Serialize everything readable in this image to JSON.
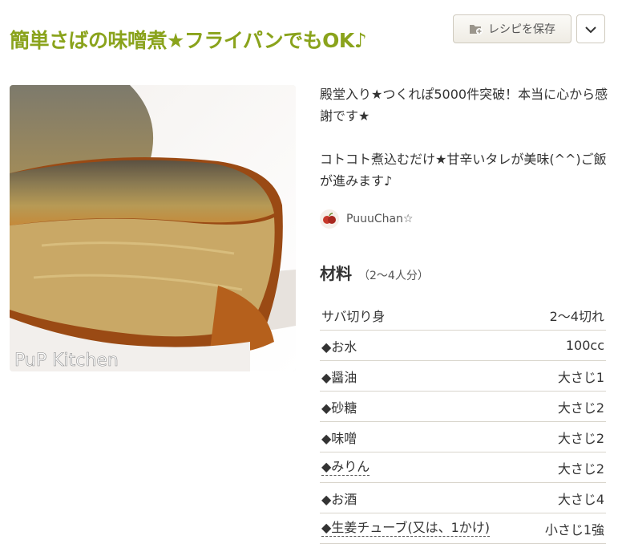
{
  "recipe": {
    "title": "簡単さばの味噌煮★フライパンでもOK♪",
    "save_label": "レシピを保存",
    "photo_watermark": "PuP Kitchen",
    "description": [
      "殿堂入り★つくれぽ5000件突破！本当に心から感謝です★",
      "コトコト煮込むだけ★甘辛いタレが美味(^^)ご飯が進みます♪"
    ],
    "author": "PuuuChan☆"
  },
  "ingredients": {
    "heading": "材料",
    "servings": "（2〜4人分）",
    "items": [
      {
        "name": "サバ切り身",
        "qty": "2〜4切れ",
        "link": false
      },
      {
        "name": "◆お水",
        "qty": "100cc",
        "link": false
      },
      {
        "name": "◆醤油",
        "qty": "大さじ1",
        "link": false
      },
      {
        "name": "◆砂糖",
        "qty": "大さじ2",
        "link": false
      },
      {
        "name": "◆味噌",
        "qty": "大さじ2",
        "link": false
      },
      {
        "name": "◆みりん",
        "qty": "大さじ2",
        "link": true
      },
      {
        "name": "◆お酒",
        "qty": "大さじ4",
        "link": false
      },
      {
        "name": "◆生姜チューブ(又は、1かけ)",
        "qty": "小さじ1強",
        "link": true
      }
    ]
  },
  "colors": {
    "title": "#8aa31c",
    "border": "#d9d5cc"
  },
  "icons": {
    "save": "folder-plus-icon",
    "more": "chevron-down-icon"
  }
}
